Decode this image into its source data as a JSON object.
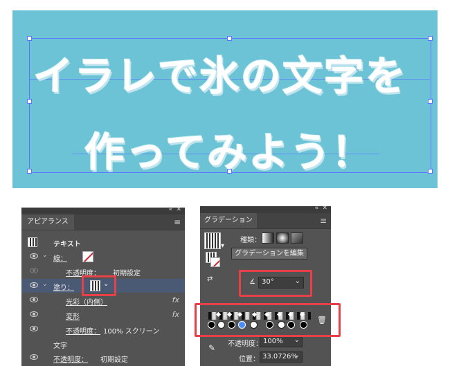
{
  "artboard": {
    "line1": "イラレで氷の文字を",
    "line2": "作ってみよう！",
    "background_color": "#6cc3d5"
  },
  "appearance_panel": {
    "tab": "アピアランス",
    "header_type": "テキスト",
    "stroke_label": "線：",
    "stroke_opacity_label": "不透明度：",
    "stroke_opacity_value": "初期設定",
    "fill_label": "塗り：",
    "effect_inner_glow": "光彩（内側）",
    "effect_transform": "変形",
    "fill_opacity_label": "不透明度：",
    "fill_opacity_value": "100% スクリーン",
    "characters_label": "文字",
    "opacity_label": "不透明度：",
    "opacity_value": "初期設定",
    "fx_icon": "fx"
  },
  "gradient_panel": {
    "tab": "グラデーション",
    "type_label": "種類：",
    "edit_button": "グラデーションを編集",
    "angle_value": "30°",
    "opacity_label": "不透明度：",
    "opacity_value": "100%",
    "location_label": "位置：",
    "location_value": "33.0726%"
  },
  "highlight_color": "#e8404a"
}
